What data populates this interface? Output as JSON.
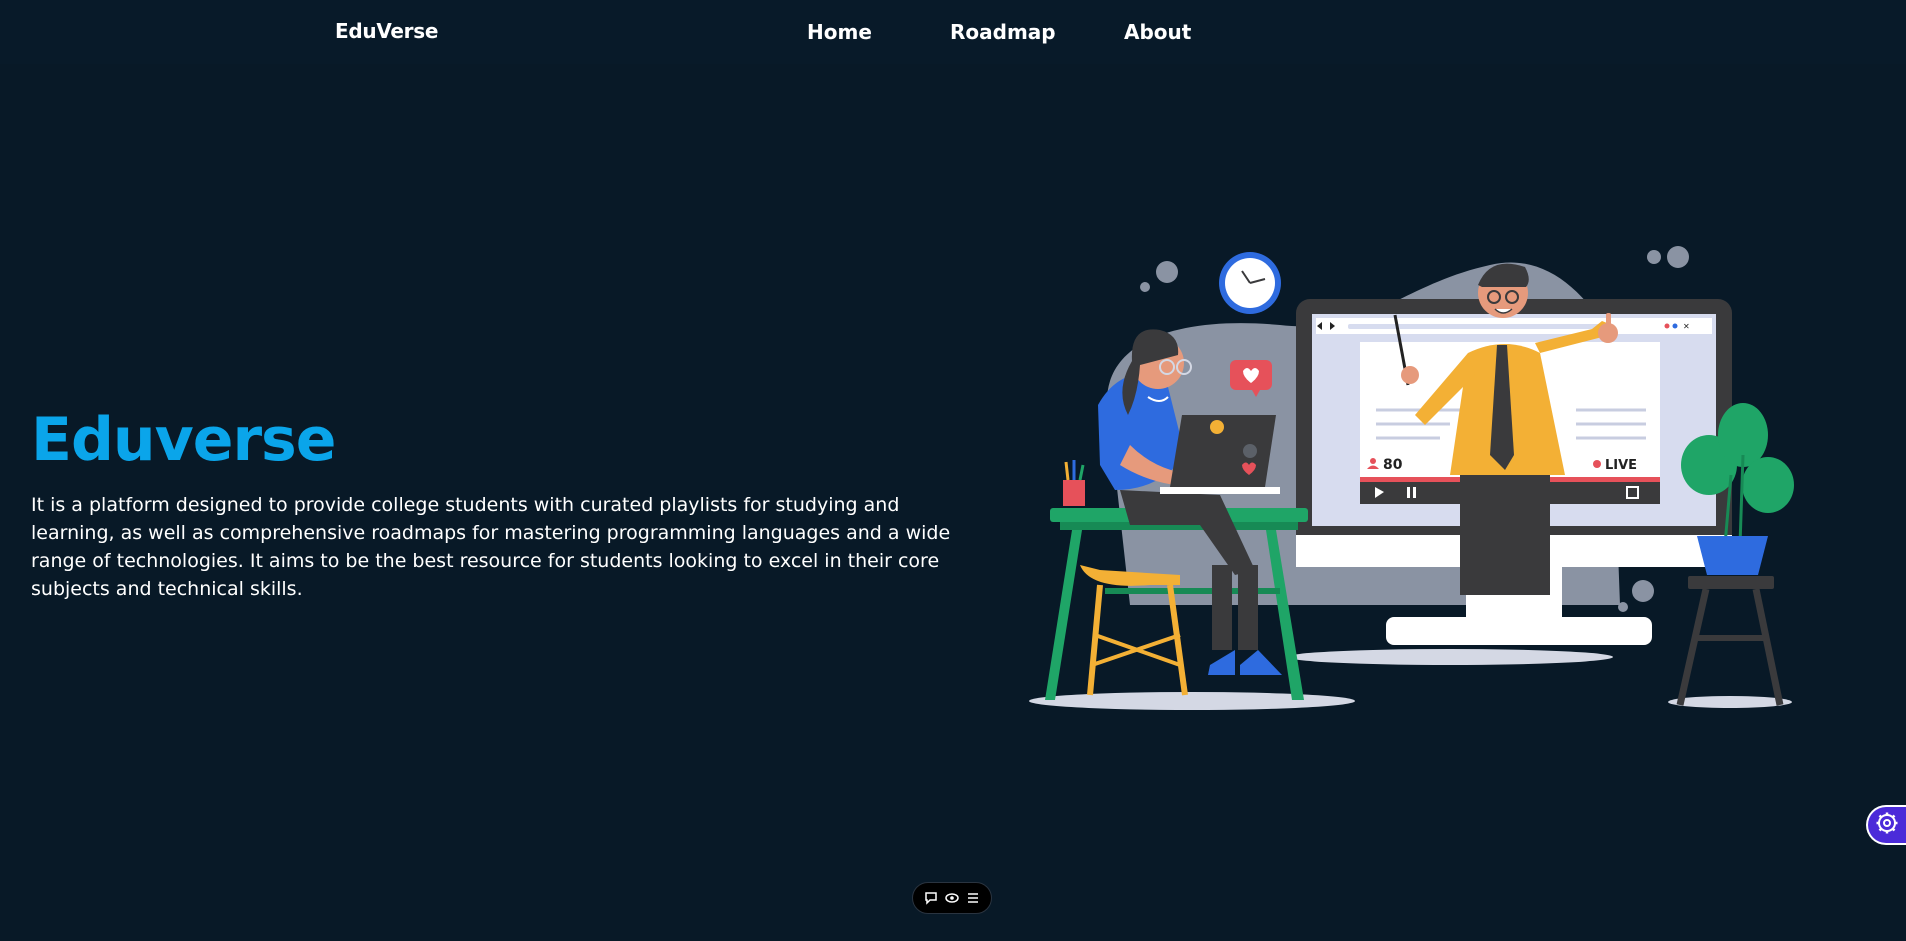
{
  "navbar": {
    "brand": "EduVerse",
    "links": [
      "Home",
      "Roadmap",
      "About"
    ]
  },
  "hero": {
    "title": "Eduverse",
    "description": "It is a platform designed to provide college students with curated playlists for studying and learning, as well as comprehensive roadmaps for mastering programming languages and a wide range of technologies. It aims to be the best resource for students looking to excel in their core subjects and technical skills."
  },
  "illustration": {
    "viewer_count": "80",
    "live_label": "LIVE"
  },
  "icons": {
    "toolbar": [
      "comment-icon",
      "eye-icon",
      "menu-icon"
    ],
    "widget": "gear-icon"
  },
  "colors": {
    "background": "#081927",
    "accent": "#0aa5ea",
    "widget": "#4b2bd9"
  }
}
